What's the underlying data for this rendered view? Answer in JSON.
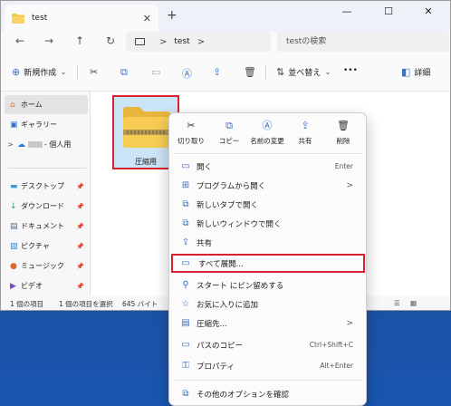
{
  "window": {
    "tab_title": "test",
    "new_tab": "+",
    "minimize": "—",
    "maximize": "☐",
    "close": "✕"
  },
  "addressbar": {
    "back": "←",
    "forward": "→",
    "up": "↑",
    "refresh": "↻",
    "path": "test",
    "separator": ">",
    "separator_end": ">",
    "search_placeholder": "testの検索"
  },
  "toolbar": {
    "new_label": "新規作成",
    "new_icon": "⊕",
    "new_arrow": "⌄",
    "sort_label": "並べ替え",
    "sort_arrow": "⌄",
    "more": "•••",
    "details_label": "詳細"
  },
  "sidebar": {
    "items": [
      {
        "label": "ホーム",
        "icon": "home-icon",
        "glyph": "⌂"
      },
      {
        "label": "ギャラリー",
        "icon": "gallery-icon",
        "glyph": "▣"
      },
      {
        "label": "- 個人用",
        "icon": "onedrive-icon",
        "glyph": "☁",
        "expand": ">"
      },
      {
        "label": "デスクトップ",
        "icon": "desktop-icon",
        "glyph": "▬"
      },
      {
        "label": "ダウンロード",
        "icon": "download-icon",
        "glyph": "↓"
      },
      {
        "label": "ドキュメント",
        "icon": "documents-icon",
        "glyph": "▤"
      },
      {
        "label": "ピクチャ",
        "icon": "pictures-icon",
        "glyph": "▨"
      },
      {
        "label": "ミュージック",
        "icon": "music-icon",
        "glyph": "●"
      },
      {
        "label": "ビデオ",
        "icon": "videos-icon",
        "glyph": "▶"
      }
    ],
    "pin": "📌"
  },
  "content": {
    "file_name": "圧縮用"
  },
  "statusbar": {
    "count": "1 個の項目",
    "selected": "1 個の項目を選択",
    "size": "645 バイト"
  },
  "context_menu": {
    "quick_actions": [
      {
        "label": "切り取り",
        "icon": "cut-icon",
        "glyph": "✂"
      },
      {
        "label": "コピー",
        "icon": "copy-icon",
        "glyph": "⧉"
      },
      {
        "label": "名前の変更",
        "icon": "rename-icon",
        "glyph": "Ⓐ"
      },
      {
        "label": "共有",
        "icon": "share-icon",
        "glyph": "⇪"
      },
      {
        "label": "削除",
        "icon": "delete-icon",
        "glyph": "🗑"
      }
    ],
    "items": [
      {
        "label": "開く",
        "shortcut": "Enter",
        "icon": "open-icon",
        "glyph": "▭"
      },
      {
        "label": "プログラムから開く",
        "submenu": ">",
        "icon": "open-with-icon",
        "glyph": "⊞"
      },
      {
        "label": "新しいタブで開く",
        "icon": "new-tab-icon",
        "glyph": "⧉"
      },
      {
        "label": "新しいウィンドウで開く",
        "icon": "new-window-icon",
        "glyph": "⧉"
      },
      {
        "label": "共有",
        "icon": "share-icon",
        "glyph": "⇪"
      },
      {
        "label": "すべて展開...",
        "icon": "extract-all-icon",
        "glyph": "▭"
      },
      {
        "label": "スタート にピン留めする",
        "icon": "pin-start-icon",
        "glyph": "⚲"
      },
      {
        "label": "お気に入りに追加",
        "icon": "favorite-icon",
        "glyph": "☆"
      },
      {
        "label": "圧縮先...",
        "submenu": ">",
        "icon": "compress-icon",
        "glyph": "▤"
      },
      {
        "label": "パスのコピー",
        "shortcut": "Ctrl+Shift+C",
        "icon": "copy-path-icon",
        "glyph": "▭"
      },
      {
        "label": "プロパティ",
        "shortcut": "Alt+Enter",
        "icon": "properties-icon",
        "glyph": "⚿"
      },
      {
        "label": "その他のオプションを確認",
        "icon": "more-options-icon",
        "glyph": "⧉"
      }
    ]
  },
  "colors": {
    "highlight_border": "#d7232f",
    "selection_bg": "#cce4f7",
    "folder_yellow": "#f5c542"
  }
}
